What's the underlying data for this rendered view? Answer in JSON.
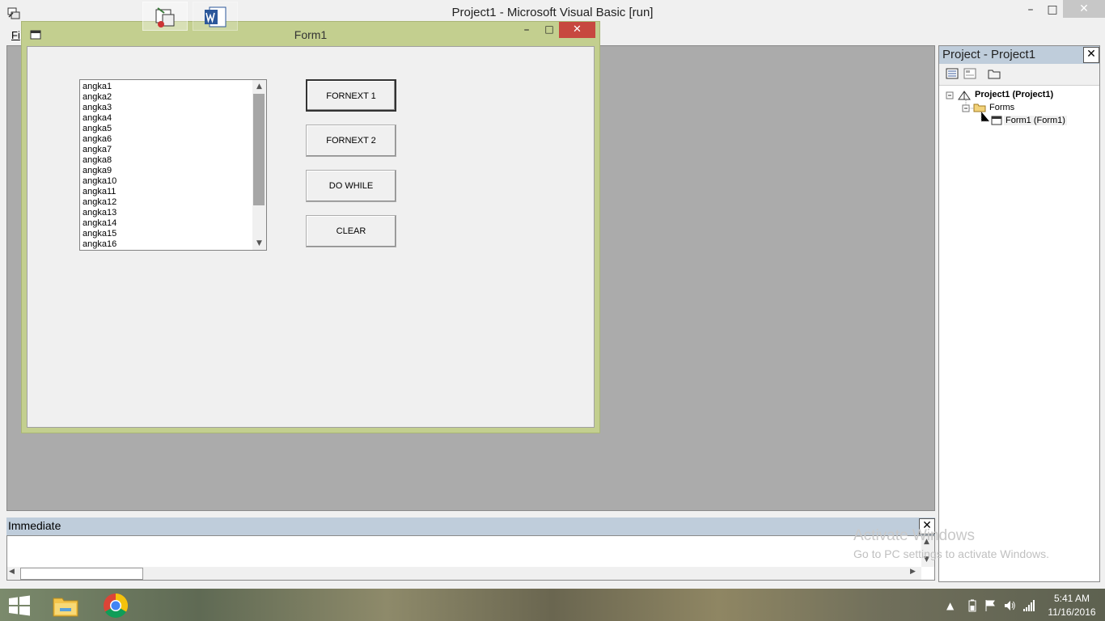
{
  "window": {
    "title": "Project1 - Microsoft Visual Basic [run]",
    "minimize_glyph": "–",
    "maximize_glyph": "□",
    "close_glyph": "✕"
  },
  "menu": {
    "file_label": "Fi"
  },
  "form1": {
    "title": "Form1",
    "minimize_glyph": "–",
    "maximize_glyph": "□",
    "close_glyph": "✕",
    "list_items": [
      "angka1",
      "angka2",
      "angka3",
      "angka4",
      "angka5",
      "angka6",
      "angka7",
      "angka8",
      "angka9",
      "angka10",
      "angka11",
      "angka12",
      "angka13",
      "angka14",
      "angka15",
      "angka16"
    ],
    "buttons": [
      "FORNEXT 1",
      "FORNEXT 2",
      "DO WHILE",
      "CLEAR"
    ]
  },
  "project_panel": {
    "title": "Project - Project1",
    "close_glyph": "✕",
    "tree": {
      "root": "Project1 (Project1)",
      "folder": "Forms",
      "item": "Form1 (Form1)"
    }
  },
  "immediate": {
    "title": "Immediate",
    "close_glyph": "✕"
  },
  "watermark": {
    "line1": "Activate Windows",
    "line2": "Go to PC settings to activate Windows."
  },
  "taskbar": {
    "time": "5:41 AM",
    "date": "11/16/2016"
  },
  "colors": {
    "form_frame": "#c3cf8f",
    "mdi_background": "#ababab",
    "panel_header": "#bfcddb",
    "close_red": "#c7483f"
  }
}
